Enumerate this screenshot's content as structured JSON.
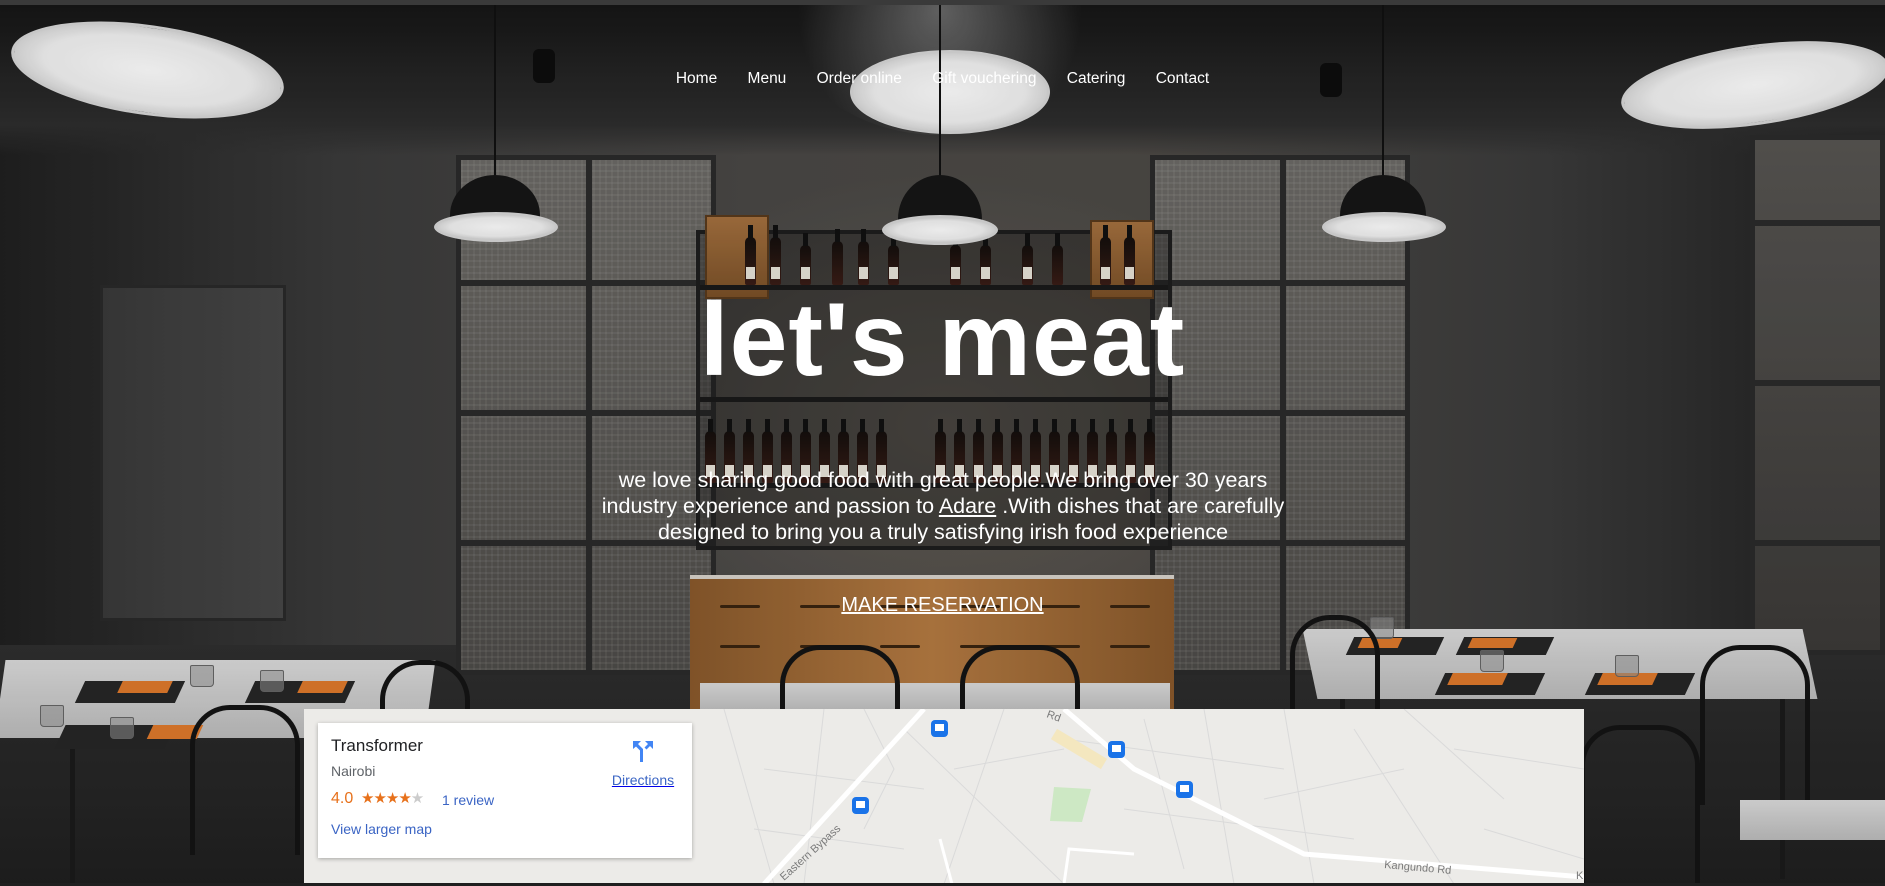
{
  "nav": {
    "items": [
      "Home",
      "Menu",
      "Order online",
      "Gift vouchering",
      "Catering",
      "Contact"
    ]
  },
  "hero": {
    "title": "let's meat",
    "tagline_before": "we love sharing good food with great people.We bring over 30 years industry experience and passion to",
    "tagline_link": "Adare",
    "tagline_after": ".With dishes that are carefully designed to bring you a truly satisfying irish food experience",
    "cta": "MAKE RESERVATION"
  },
  "map": {
    "place_name": "Transformer",
    "locality": "Nairobi",
    "rating": "4.0",
    "stars_filled": 4,
    "stars_total": 5,
    "reviews_link": "1 review",
    "larger_map_link": "View larger map",
    "directions_label": "Directions",
    "road_labels": [
      "Eastern Bypass",
      "Kangundo Rd",
      "Rd",
      "K"
    ]
  },
  "colors": {
    "nav_text": "#ffffff",
    "hero_text": "#ffffff",
    "map_link": "#3a64c4",
    "rating": "#e7711b",
    "map_background": "#ecebe8"
  },
  "icons": [
    "directions-icon",
    "bus-stop-icon"
  ]
}
